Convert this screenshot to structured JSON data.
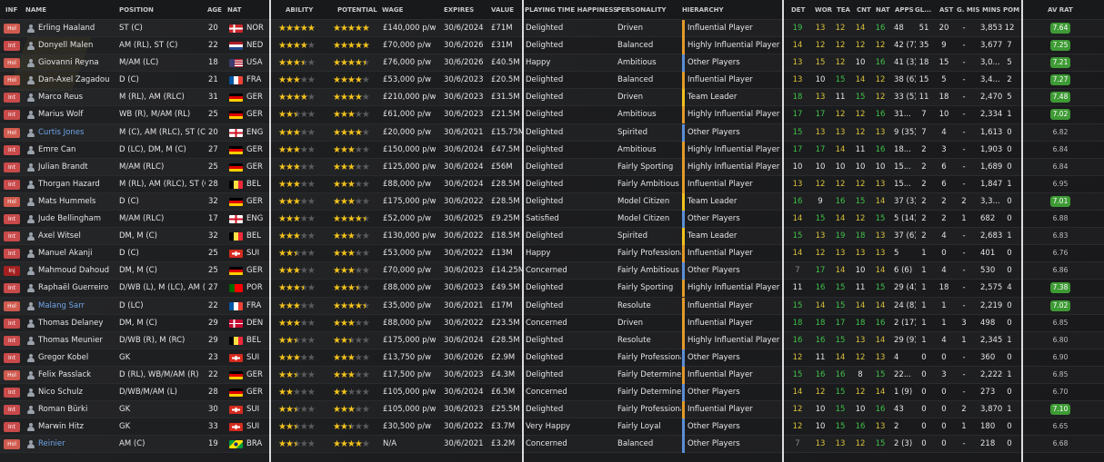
{
  "columns": {
    "inf": "INF",
    "name": "NAME",
    "position": "POSITION",
    "age": "AGE",
    "nat": "NAT",
    "ability": "ABILITY",
    "potential": "POTENTIAL",
    "wage": "WAGE",
    "expires": "EXPIRES",
    "value": "VALUE",
    "happiness": "PLAYING TIME HAPPINESS",
    "personality": "PERSONALITY",
    "hierarchy": "HIERARCHY",
    "det": "DET",
    "wor": "WOR",
    "tea": "TEA",
    "cnt": "CNT",
    "natr": "NAT",
    "apps": "APPS",
    "gls": "GL...",
    "ast": "AST",
    "gmis": "G. MIS",
    "mins": "MINS",
    "pom": "POM",
    "avrat": "AV RAT"
  },
  "colors": {
    "green": "#3fc24a",
    "yellow": "#d9c23b",
    "rating_bg": "#3e9a35",
    "star": "#f2c21d",
    "hier_orange": "#e39a2b",
    "hier_yellow": "#f2c21d",
    "hier_blue": "#5b8fd6"
  },
  "players": [
    {
      "inf": "Hol",
      "name": "Erling Haaland",
      "pos": "ST (C)",
      "age": "20",
      "flag": "NOR",
      "nat": "NOR",
      "ab": 5,
      "pot": 5,
      "wage": "£140,000 p/w",
      "exp": "30/6/2024",
      "val": "£71M",
      "hap": "Delighted",
      "pers": "Driven",
      "hier": "Influential Player",
      "hc": "orange",
      "det": "19",
      "wor": "13",
      "tea": "12",
      "cnt": "14",
      "natr": "16",
      "apps": "48",
      "gls": "51",
      "ast": "20",
      "gmis": "-",
      "mins": "3,853",
      "pom": "12",
      "rat": "7.64",
      "ratHi": true,
      "dc": [
        "g",
        "y",
        "y",
        "y",
        "g"
      ]
    },
    {
      "inf": "Int",
      "name": "Donyell Malen",
      "pos": "AM (RL), ST (C)",
      "age": "22",
      "flag": "NED",
      "nat": "NED",
      "ab": 4,
      "pot": 5,
      "wage": "£70,000 p/w",
      "exp": "30/6/2026",
      "val": "£31M",
      "hap": "Delighted",
      "pers": "Balanced",
      "hier": "Highly Influential Player",
      "hc": "orange",
      "det": "14",
      "wor": "12",
      "tea": "12",
      "cnt": "12",
      "natr": "12",
      "apps": "42 (7)",
      "gls": "35",
      "ast": "9",
      "gmis": "-",
      "mins": "3,677",
      "pom": "7",
      "rat": "7.25",
      "ratHi": true,
      "dc": [
        "y",
        "y",
        "y",
        "y",
        "y"
      ]
    },
    {
      "inf": "Hol",
      "name": "Giovanni Reyna",
      "pos": "M/AM (LC)",
      "age": "18",
      "flag": "USA",
      "nat": "USA",
      "ab": 3.5,
      "pot": 4.5,
      "wage": "£76,000 p/w",
      "exp": "30/6/2026",
      "val": "£40.5M",
      "hap": "Happy",
      "pers": "Ambitious",
      "hier": "Other Players",
      "hc": "blue",
      "det": "13",
      "wor": "15",
      "tea": "12",
      "cnt": "10",
      "natr": "16",
      "apps": "41 (3)",
      "gls": "18",
      "ast": "15",
      "gmis": "-",
      "mins": "3,0...",
      "pom": "5",
      "rat": "7.21",
      "ratHi": true,
      "dc": [
        "y",
        "y",
        "y",
        "w",
        "g"
      ]
    },
    {
      "inf": "Hol",
      "name": "Dan-Axel Zagadou",
      "pos": "D (C)",
      "age": "21",
      "flag": "FRA",
      "nat": "FRA",
      "ab": 3,
      "pot": 4,
      "wage": "£53,000 p/w",
      "exp": "30/6/2023",
      "val": "£20.5M",
      "hap": "Delighted",
      "pers": "Balanced",
      "hier": "Influential Player",
      "hc": "orange",
      "det": "13",
      "wor": "10",
      "tea": "15",
      "cnt": "14",
      "natr": "12",
      "apps": "38 (6)",
      "gls": "15",
      "ast": "5",
      "gmis": "-",
      "mins": "3,4...",
      "pom": "2",
      "rat": "7.27",
      "ratHi": true,
      "dc": [
        "y",
        "w",
        "g",
        "y",
        "y"
      ]
    },
    {
      "inf": "Int",
      "name": "Marco Reus",
      "pos": "M (RL), AM (RLC)",
      "age": "31",
      "flag": "GER",
      "nat": "GER",
      "ab": 4,
      "pot": 4,
      "wage": "£210,000 p/w",
      "exp": "30/6/2023",
      "val": "£31.5M",
      "hap": "Delighted",
      "pers": "Driven",
      "hier": "Team Leader",
      "hc": "yellow",
      "det": "18",
      "wor": "13",
      "tea": "11",
      "cnt": "15",
      "natr": "12",
      "apps": "33 (5)",
      "gls": "11",
      "ast": "18",
      "gmis": "-",
      "mins": "2,470",
      "pom": "5",
      "rat": "7.48",
      "ratHi": true,
      "dc": [
        "g",
        "y",
        "w",
        "g",
        "y"
      ]
    },
    {
      "inf": "Int",
      "name": "Marius Wolf",
      "pos": "WB (R), M/AM (RL)",
      "age": "25",
      "flag": "GER",
      "nat": "GER",
      "ab": 2.5,
      "pot": 3,
      "wage": "£61,000 p/w",
      "exp": "30/6/2023",
      "val": "£21.5M",
      "hap": "Delighted",
      "pers": "Ambitious",
      "hier": "Highly Influential Player",
      "hc": "orange",
      "det": "17",
      "wor": "17",
      "tea": "12",
      "cnt": "12",
      "natr": "16",
      "apps": "31...",
      "gls": "7",
      "ast": "10",
      "gmis": "-",
      "mins": "2,334",
      "pom": "1",
      "rat": "7.02",
      "ratHi": true,
      "dc": [
        "g",
        "g",
        "y",
        "y",
        "g"
      ]
    },
    {
      "inf": "Hol",
      "name": "Curtis Jones",
      "pos": "M (C), AM (RLC), ST (C)",
      "age": "20",
      "flag": "ENG",
      "nat": "ENG",
      "ab": 3,
      "pot": 4,
      "wage": "£20,000 p/w",
      "exp": "30/6/2021",
      "val": "£15.75M",
      "hap": "Delighted",
      "pers": "Spirited",
      "hier": "Other Players",
      "hc": "blue",
      "det": "15",
      "wor": "13",
      "tea": "13",
      "cnt": "12",
      "natr": "13",
      "apps": "9 (35)",
      "gls": "7",
      "ast": "4",
      "gmis": "-",
      "mins": "1,613",
      "pom": "0",
      "rat": "6.82",
      "ratHi": false,
      "blue": true,
      "dc": [
        "g",
        "y",
        "y",
        "y",
        "y"
      ]
    },
    {
      "inf": "Int",
      "name": "Emre Can",
      "pos": "D (LC), DM, M (C)",
      "age": "27",
      "flag": "GER",
      "nat": "GER",
      "ab": 3,
      "pot": 3,
      "wage": "£150,000 p/w",
      "exp": "30/6/2024",
      "val": "£47.5M",
      "hap": "Delighted",
      "pers": "Ambitious",
      "hier": "Highly Influential Player",
      "hc": "orange",
      "det": "17",
      "wor": "17",
      "tea": "14",
      "cnt": "11",
      "natr": "16",
      "apps": "18...",
      "gls": "2",
      "ast": "3",
      "gmis": "-",
      "mins": "1,903",
      "pom": "0",
      "rat": "6.84",
      "ratHi": false,
      "dc": [
        "g",
        "g",
        "y",
        "w",
        "g"
      ]
    },
    {
      "inf": "Int",
      "name": "Julian Brandt",
      "pos": "M/AM (RLC)",
      "age": "25",
      "flag": "GER",
      "nat": "GER",
      "ab": 3,
      "pot": 3,
      "wage": "£125,000 p/w",
      "exp": "30/6/2024",
      "val": "£56M",
      "hap": "Delighted",
      "pers": "Fairly Sporting",
      "hier": "Highly Influential Player",
      "hc": "orange",
      "det": "10",
      "wor": "10",
      "tea": "10",
      "cnt": "10",
      "natr": "10",
      "apps": "15...",
      "gls": "2",
      "ast": "6",
      "gmis": "-",
      "mins": "1,689",
      "pom": "0",
      "rat": "6.84",
      "ratHi": false,
      "dc": [
        "w",
        "w",
        "w",
        "w",
        "w"
      ]
    },
    {
      "inf": "Int",
      "name": "Thorgan Hazard",
      "pos": "M (RL), AM (RLC), ST (C)",
      "age": "28",
      "flag": "BEL",
      "nat": "BEL",
      "ab": 3,
      "pot": 3,
      "wage": "£88,000 p/w",
      "exp": "30/6/2024",
      "val": "£28.5M",
      "hap": "Delighted",
      "pers": "Fairly Ambitious",
      "hier": "Influential Player",
      "hc": "orange",
      "det": "13",
      "wor": "12",
      "tea": "12",
      "cnt": "12",
      "natr": "13",
      "apps": "15...",
      "gls": "2",
      "ast": "6",
      "gmis": "-",
      "mins": "1,847",
      "pom": "1",
      "rat": "6.95",
      "ratHi": false,
      "dc": [
        "y",
        "y",
        "y",
        "y",
        "y"
      ]
    },
    {
      "inf": "Hol",
      "name": "Mats Hummels",
      "pos": "D (C)",
      "age": "32",
      "flag": "GER",
      "nat": "GER",
      "ab": 3,
      "pot": 3,
      "wage": "£175,000 p/w",
      "exp": "30/6/2022",
      "val": "£28.5M",
      "hap": "Delighted",
      "pers": "Model Citizen",
      "hier": "Team Leader",
      "hc": "yellow",
      "det": "16",
      "wor": "9",
      "tea": "16",
      "cnt": "15",
      "natr": "14",
      "apps": "37 (3)",
      "gls": "2",
      "ast": "2",
      "gmis": "2",
      "mins": "3,3...",
      "pom": "0",
      "rat": "7.01",
      "ratHi": true,
      "dc": [
        "g",
        "w",
        "g",
        "g",
        "y"
      ]
    },
    {
      "inf": "Int",
      "name": "Jude Bellingham",
      "pos": "M/AM (RLC)",
      "age": "17",
      "flag": "ENG",
      "nat": "ENG",
      "ab": 3,
      "pot": 4.5,
      "wage": "£52,000 p/w",
      "exp": "30/6/2025",
      "val": "£9.25M",
      "hap": "Satisfied",
      "pers": "Model Citizen",
      "hier": "Other Players",
      "hc": "blue",
      "det": "14",
      "wor": "15",
      "tea": "14",
      "cnt": "12",
      "natr": "15",
      "apps": "5 (14)",
      "gls": "2",
      "ast": "2",
      "gmis": "1",
      "mins": "682",
      "pom": "0",
      "rat": "6.88",
      "ratHi": false,
      "dc": [
        "y",
        "g",
        "y",
        "y",
        "g"
      ]
    },
    {
      "inf": "Int",
      "name": "Axel Witsel",
      "pos": "DM, M (C)",
      "age": "32",
      "flag": "BEL",
      "nat": "BEL",
      "ab": 3,
      "pot": 3,
      "wage": "£130,000 p/w",
      "exp": "30/6/2022",
      "val": "£18.5M",
      "hap": "Delighted",
      "pers": "Spirited",
      "hier": "Team Leader",
      "hc": "yellow",
      "det": "15",
      "wor": "13",
      "tea": "19",
      "cnt": "18",
      "natr": "13",
      "apps": "37 (6)",
      "gls": "2",
      "ast": "4",
      "gmis": "-",
      "mins": "2,683",
      "pom": "1",
      "rat": "6.83",
      "ratHi": false,
      "dc": [
        "g",
        "y",
        "g",
        "g",
        "y"
      ]
    },
    {
      "inf": "Int",
      "name": "Manuel Akanji",
      "pos": "D (C)",
      "age": "25",
      "flag": "SUI",
      "nat": "SUI",
      "ab": 2.5,
      "pot": 3,
      "wage": "£53,000 p/w",
      "exp": "30/6/2022",
      "val": "£13M",
      "hap": "Happy",
      "pers": "Fairly Professional",
      "hier": "Influential Player",
      "hc": "orange",
      "det": "14",
      "wor": "12",
      "tea": "13",
      "cnt": "13",
      "natr": "13",
      "apps": "5",
      "gls": "1",
      "ast": "0",
      "gmis": "-",
      "mins": "401",
      "pom": "0",
      "rat": "6.76",
      "ratHi": false,
      "dc": [
        "y",
        "y",
        "y",
        "y",
        "y"
      ]
    },
    {
      "inf": "Inj",
      "name": "Mahmoud Dahoud",
      "pos": "DM, M (C)",
      "age": "25",
      "flag": "GER",
      "nat": "GER",
      "ab": 3,
      "pot": 3,
      "wage": "£70,000 p/w",
      "exp": "30/6/2023",
      "val": "£14.25M",
      "hap": "Concerned",
      "pers": "Fairly Ambitious",
      "hier": "Other Players",
      "hc": "blue",
      "det": "7",
      "wor": "17",
      "tea": "14",
      "cnt": "10",
      "natr": "14",
      "apps": "6 (6)",
      "gls": "1",
      "ast": "4",
      "gmis": "-",
      "mins": "530",
      "pom": "0",
      "rat": "6.86",
      "ratHi": false,
      "dc": [
        "gr",
        "g",
        "y",
        "w",
        "y"
      ]
    },
    {
      "inf": "Int",
      "name": "Raphaël Guerreiro",
      "pos": "D/WB (L), M (LC), AM (L)",
      "age": "27",
      "flag": "POR",
      "nat": "POR",
      "ab": 3.5,
      "pot": 3.5,
      "wage": "£88,000 p/w",
      "exp": "30/6/2023",
      "val": "£49.5M",
      "hap": "Delighted",
      "pers": "Fairly Sporting",
      "hier": "Highly Influential Player",
      "hc": "orange",
      "det": "11",
      "wor": "16",
      "tea": "15",
      "cnt": "11",
      "natr": "15",
      "apps": "29 (4)",
      "gls": "1",
      "ast": "18",
      "gmis": "-",
      "mins": "2,575",
      "pom": "4",
      "rat": "7.38",
      "ratHi": true,
      "dc": [
        "w",
        "g",
        "g",
        "w",
        "g"
      ]
    },
    {
      "inf": "Hol",
      "name": "Malang Sarr",
      "pos": "D (LC)",
      "age": "22",
      "flag": "FRA",
      "nat": "FRA",
      "ab": 3,
      "pot": 4.5,
      "wage": "£35,000 p/w",
      "exp": "30/6/2021",
      "val": "£17M",
      "hap": "Delighted",
      "pers": "Resolute",
      "hier": "Influential Player",
      "hc": "orange",
      "det": "15",
      "wor": "14",
      "tea": "15",
      "cnt": "14",
      "natr": "14",
      "apps": "24 (8)",
      "gls": "1",
      "ast": "1",
      "gmis": "-",
      "mins": "2,219",
      "pom": "0",
      "rat": "7.02",
      "ratHi": true,
      "blue": true,
      "dc": [
        "g",
        "y",
        "g",
        "y",
        "y"
      ]
    },
    {
      "inf": "Int",
      "name": "Thomas Delaney",
      "pos": "DM, M (C)",
      "age": "29",
      "flag": "DEN",
      "nat": "DEN",
      "ab": 3,
      "pot": 3,
      "wage": "£88,000 p/w",
      "exp": "30/6/2022",
      "val": "£23.5M",
      "hap": "Concerned",
      "pers": "Driven",
      "hier": "Influential Player",
      "hc": "orange",
      "det": "18",
      "wor": "18",
      "tea": "17",
      "cnt": "18",
      "natr": "16",
      "apps": "2 (17)",
      "gls": "1",
      "ast": "1",
      "gmis": "3",
      "mins": "498",
      "pom": "0",
      "rat": "6.85",
      "ratHi": false,
      "dc": [
        "g",
        "g",
        "g",
        "g",
        "g"
      ]
    },
    {
      "inf": "Int",
      "name": "Thomas Meunier",
      "pos": "D/WB (R), M (RC)",
      "age": "29",
      "flag": "BEL",
      "nat": "BEL",
      "ab": 2.5,
      "pot": 2.5,
      "wage": "£175,000 p/w",
      "exp": "30/6/2024",
      "val": "£28.5M",
      "hap": "Delighted",
      "pers": "Resolute",
      "hier": "Highly Influential Player",
      "hc": "orange",
      "det": "16",
      "wor": "16",
      "tea": "15",
      "cnt": "13",
      "natr": "14",
      "apps": "29 (9)",
      "gls": "1",
      "ast": "4",
      "gmis": "1",
      "mins": "2,345",
      "pom": "1",
      "rat": "6.80",
      "ratHi": false,
      "dc": [
        "g",
        "g",
        "g",
        "y",
        "y"
      ]
    },
    {
      "inf": "Int",
      "name": "Gregor Kobel",
      "pos": "GK",
      "age": "23",
      "flag": "SUI",
      "nat": "SUI",
      "ab": 3,
      "pot": 3,
      "wage": "£13,750 p/w",
      "exp": "30/6/2026",
      "val": "£2.9M",
      "hap": "Delighted",
      "pers": "Fairly Professional",
      "hier": "Other Players",
      "hc": "blue",
      "det": "12",
      "wor": "11",
      "tea": "14",
      "cnt": "12",
      "natr": "13",
      "apps": "4",
      "gls": "0",
      "ast": "0",
      "gmis": "-",
      "mins": "360",
      "pom": "0",
      "rat": "6.90",
      "ratHi": false,
      "dc": [
        "y",
        "w",
        "y",
        "y",
        "y"
      ]
    },
    {
      "inf": "Hol",
      "name": "Felix Passlack",
      "pos": "D (RL), WB/M/AM (R)",
      "age": "22",
      "flag": "GER",
      "nat": "GER",
      "ab": 2.5,
      "pot": 3,
      "wage": "£17,500 p/w",
      "exp": "30/6/2023",
      "val": "£4.3M",
      "hap": "Delighted",
      "pers": "Fairly Determined",
      "hier": "Influential Player",
      "hc": "orange",
      "det": "15",
      "wor": "16",
      "tea": "16",
      "cnt": "8",
      "natr": "15",
      "apps": "22...",
      "gls": "0",
      "ast": "3",
      "gmis": "-",
      "mins": "2,222",
      "pom": "1",
      "rat": "6.85",
      "ratHi": false,
      "dc": [
        "g",
        "g",
        "g",
        "w",
        "g"
      ]
    },
    {
      "inf": "Int",
      "name": "Nico Schulz",
      "pos": "D/WB/M/AM (L)",
      "age": "28",
      "flag": "GER",
      "nat": "GER",
      "ab": 2,
      "pot": 2,
      "wage": "£105,000 p/w",
      "exp": "30/6/2024",
      "val": "£6.5M",
      "hap": "Concerned",
      "pers": "Fairly Determined",
      "hier": "Other Players",
      "hc": "blue",
      "det": "14",
      "wor": "12",
      "tea": "15",
      "cnt": "12",
      "natr": "14",
      "apps": "1 (9)",
      "gls": "0",
      "ast": "0",
      "gmis": "-",
      "mins": "273",
      "pom": "0",
      "rat": "6.70",
      "ratHi": false,
      "dc": [
        "y",
        "y",
        "g",
        "y",
        "y"
      ]
    },
    {
      "inf": "Int",
      "name": "Roman Bürki",
      "pos": "GK",
      "age": "30",
      "flag": "SUI",
      "nat": "SUI",
      "ab": 2.5,
      "pot": 3,
      "wage": "£105,000 p/w",
      "exp": "30/6/2023",
      "val": "£25.5M",
      "hap": "Delighted",
      "pers": "Fairly Professional",
      "hier": "Influential Player",
      "hc": "orange",
      "det": "12",
      "wor": "10",
      "tea": "15",
      "cnt": "10",
      "natr": "16",
      "apps": "43",
      "gls": "0",
      "ast": "0",
      "gmis": "2",
      "mins": "3,870",
      "pom": "1",
      "rat": "7.10",
      "ratHi": true,
      "dc": [
        "y",
        "w",
        "g",
        "w",
        "g"
      ]
    },
    {
      "inf": "Int",
      "name": "Marwin Hitz",
      "pos": "GK",
      "age": "33",
      "flag": "SUI",
      "nat": "SUI",
      "ab": 2.5,
      "pot": 2.5,
      "wage": "£30,500 p/w",
      "exp": "30/6/2022",
      "val": "£3.7M",
      "hap": "Very Happy",
      "pers": "Fairly Loyal",
      "hier": "Other Players",
      "hc": "blue",
      "det": "12",
      "wor": "10",
      "tea": "15",
      "cnt": "16",
      "natr": "13",
      "apps": "2",
      "gls": "0",
      "ast": "0",
      "gmis": "1",
      "mins": "180",
      "pom": "0",
      "rat": "6.65",
      "ratHi": false,
      "dc": [
        "y",
        "w",
        "g",
        "g",
        "y"
      ]
    },
    {
      "inf": "Hol",
      "name": "Reinier",
      "pos": "AM (C)",
      "age": "19",
      "flag": "BRA",
      "nat": "BRA",
      "ab": 2.5,
      "pot": 4,
      "wage": "N/A",
      "exp": "30/6/2021",
      "val": "£3.2M",
      "hap": "Concerned",
      "pers": "Balanced",
      "hier": "Other Players",
      "hc": "blue",
      "det": "7",
      "wor": "13",
      "tea": "13",
      "cnt": "12",
      "natr": "15",
      "apps": "2 (3)",
      "gls": "0",
      "ast": "0",
      "gmis": "-",
      "mins": "218",
      "pom": "0",
      "rat": "6.68",
      "ratHi": false,
      "blue": true,
      "dc": [
        "gr",
        "y",
        "y",
        "y",
        "g"
      ]
    }
  ]
}
